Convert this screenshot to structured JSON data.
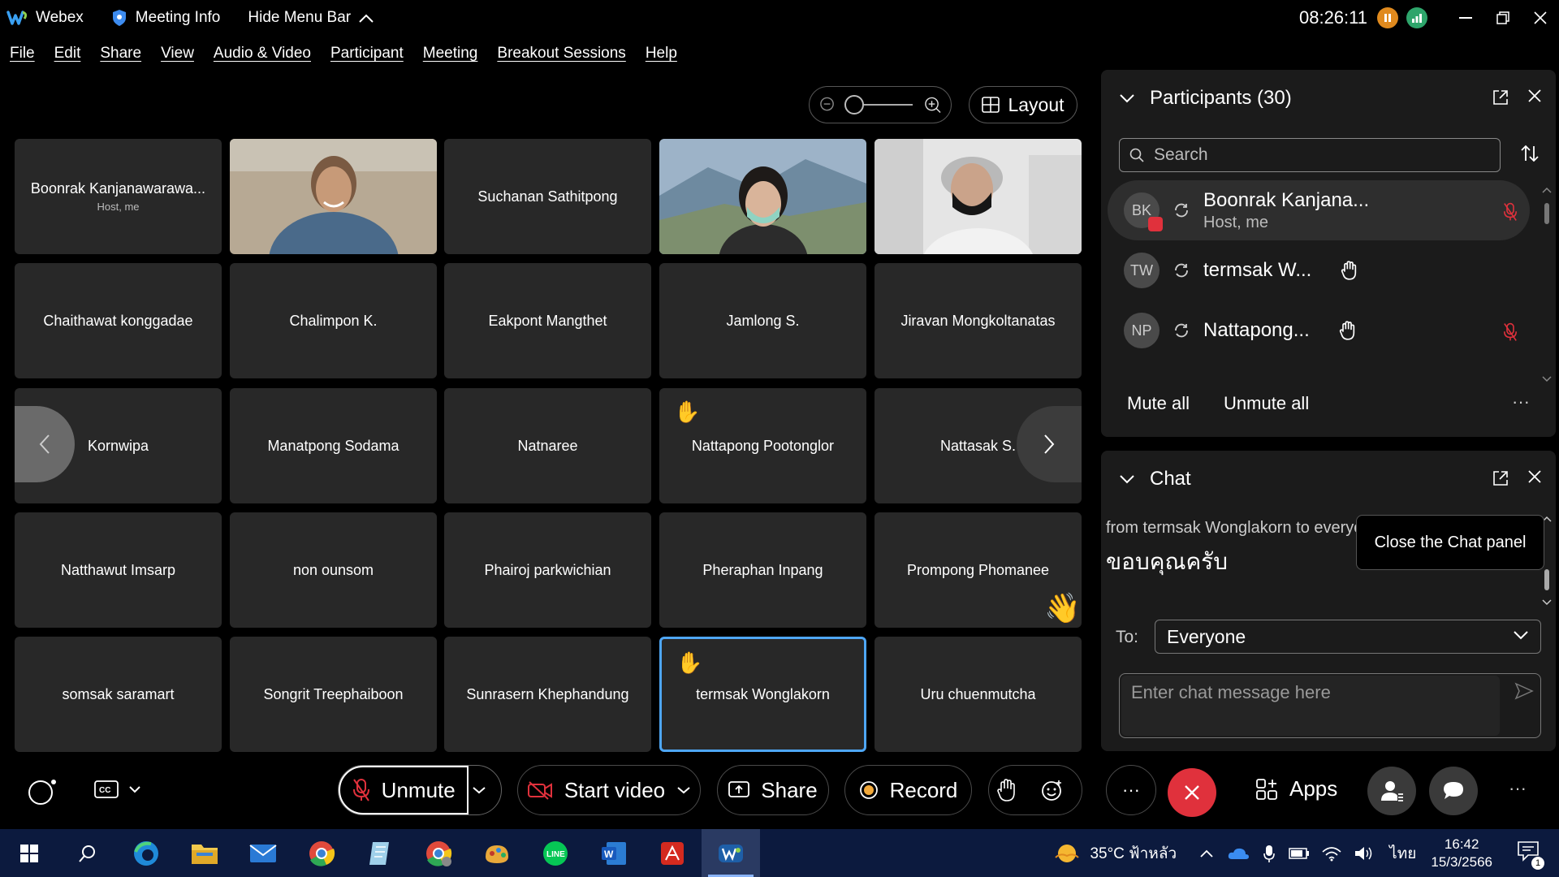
{
  "titlebar": {
    "app_name": "Webex",
    "meeting_info": "Meeting Info",
    "hide_menu": "Hide Menu Bar",
    "clock": "08:26:11",
    "colors": {
      "pause": "#e08a1e",
      "stats": "#2ea56b"
    }
  },
  "menubar": [
    "File",
    "Edit",
    "Share",
    "View",
    "Audio & Video",
    "Participant",
    "Meeting",
    "Breakout Sessions",
    "Help"
  ],
  "layout_label": "Layout",
  "tiles": [
    {
      "name": "Boonrak Kanjanawarawa...",
      "sub": "Host, me"
    },
    {
      "name": "",
      "video": "v1"
    },
    {
      "name": "Suchanan Sathitpong"
    },
    {
      "name": "",
      "video": "v2"
    },
    {
      "name": "",
      "video": "v3"
    },
    {
      "name": "Chaithawat konggadae"
    },
    {
      "name": "Chalimpon K."
    },
    {
      "name": "Eakpont Mangthet"
    },
    {
      "name": "Jamlong S."
    },
    {
      "name": "Jiravan Mongkoltanatas"
    },
    {
      "name": "Kornwipa"
    },
    {
      "name": "Manatpong Sodama"
    },
    {
      "name": "Natnaree"
    },
    {
      "name": "Nattapong Pootonglor",
      "hand": true
    },
    {
      "name": "Nattasak S."
    },
    {
      "name": "Natthawut Imsarp"
    },
    {
      "name": "non ounsom"
    },
    {
      "name": "Phairoj parkwichian"
    },
    {
      "name": "Pheraphan Inpang"
    },
    {
      "name": "Prompong Phomanee"
    },
    {
      "name": "somsak saramart"
    },
    {
      "name": "Songrit Treephaiboon"
    },
    {
      "name": "Sunrasern Khephandung"
    },
    {
      "name": "termsak Wonglakorn",
      "hand": true,
      "active": true
    },
    {
      "name": "Uru chuenmutcha"
    }
  ],
  "participants": {
    "title": "Participants (30)",
    "search_placeholder": "Search",
    "list": [
      {
        "initials": "BK",
        "name": "Boonrak Kanjana...",
        "role": "Host, me",
        "muted": true,
        "selected": true
      },
      {
        "initials": "TW",
        "name": "termsak W...",
        "hand": true,
        "muted": false
      },
      {
        "initials": "NP",
        "name": "Nattapong...",
        "hand": true,
        "muted": true
      }
    ],
    "mute_all": "Mute all",
    "unmute_all": "Unmute all"
  },
  "chat": {
    "title": "Chat",
    "from": "from termsak Wonglakorn to everyone",
    "message": "ขอบคุณครับ",
    "tooltip": "Close the Chat panel",
    "to_label": "To:",
    "to_value": "Everyone",
    "input_placeholder": "Enter chat message here"
  },
  "controls": {
    "unmute": "Unmute",
    "start_video": "Start video",
    "share": "Share",
    "record": "Record",
    "apps": "Apps",
    "leave_color": "#e0313c"
  },
  "taskbar": {
    "weather": "35°C ฟ้าหลัว",
    "language": "ไทย",
    "time": "16:42",
    "date": "15/3/2566",
    "notifications": "1"
  }
}
